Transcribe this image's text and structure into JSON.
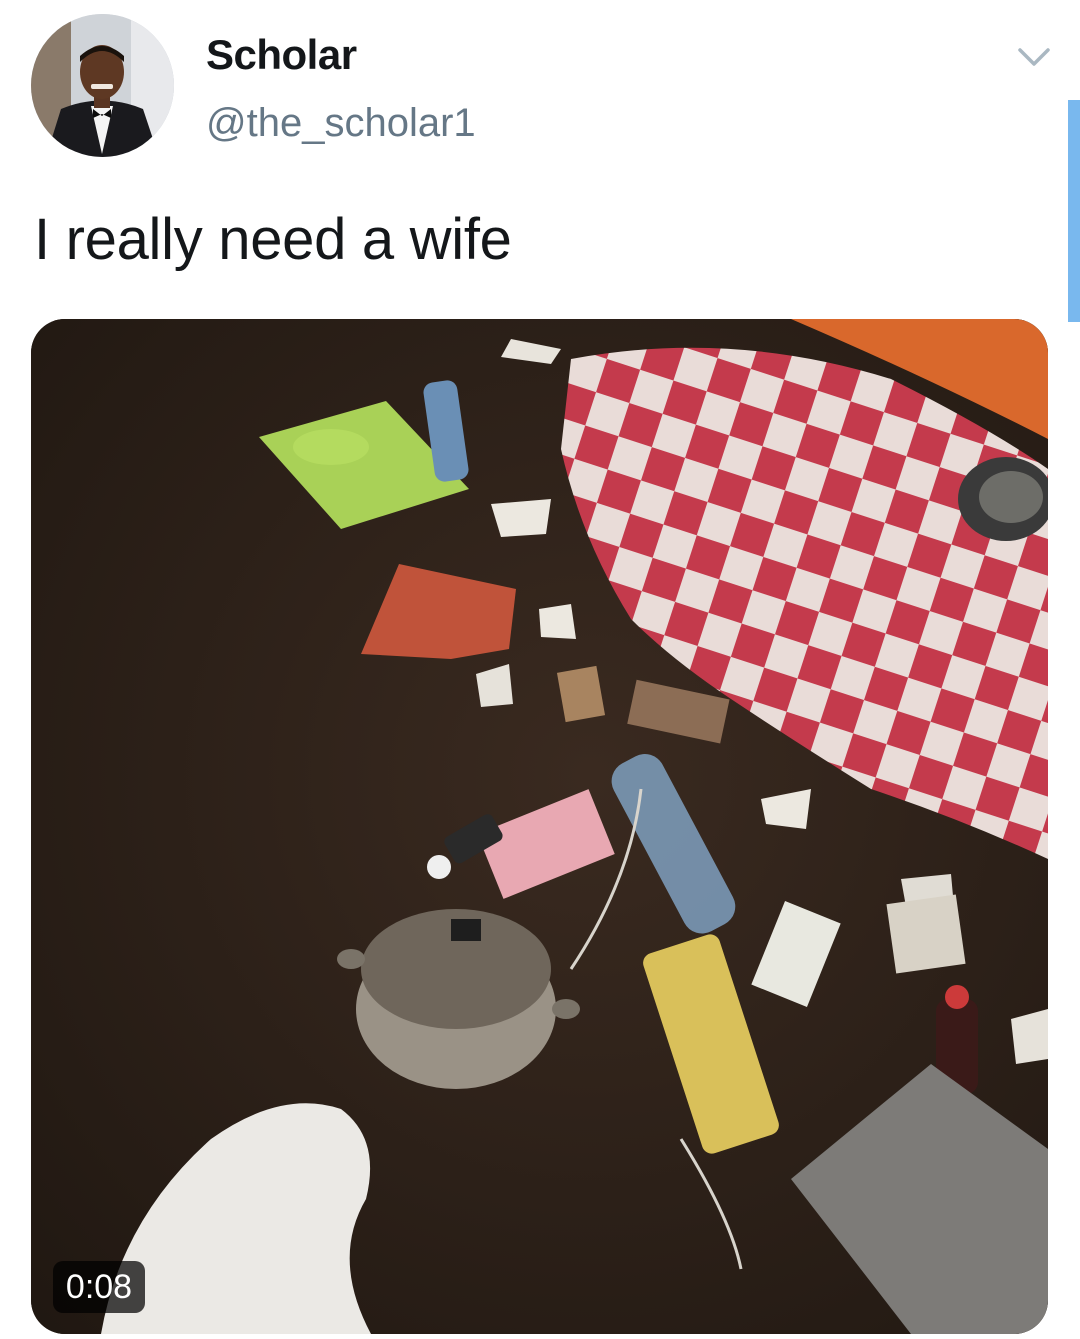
{
  "tweet": {
    "author": {
      "display_name": "Scholar",
      "handle": "@the_scholar1",
      "avatar_icon": "profile-photo-man-in-tuxedo"
    },
    "menu_icon": "chevron-down-icon",
    "text": "I really need a wife",
    "media": {
      "type": "video",
      "duration": "0:08",
      "description_icon": "messy-room-video-thumbnail"
    }
  },
  "colors": {
    "text_primary": "#14171a",
    "text_secondary": "#657786",
    "scroll_indicator": "#79b8ee",
    "duration_badge_bg": "#000000"
  }
}
